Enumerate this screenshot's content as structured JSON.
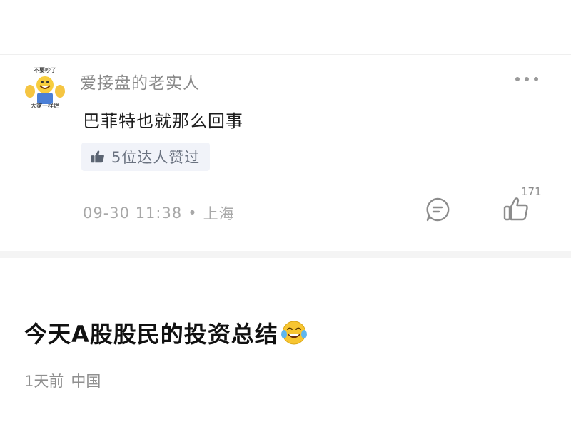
{
  "comment": {
    "avatar": {
      "caption_top": "不要吵了",
      "caption_bottom": "大家一样烂"
    },
    "username": "爱接盘的老实人",
    "text": "巴菲特也就那么回事",
    "expert_badge": {
      "icon": "thumbs-up-icon",
      "label": "5位达人赞过"
    },
    "date": "09-30 11:38",
    "separator": "•",
    "location": "上海",
    "reply_icon": "reply-bubble-icon",
    "like_icon": "like-thumb-icon",
    "like_count": "171",
    "more_icon": "more-dots-icon"
  },
  "post": {
    "title": "今天A股股民的投资总结",
    "title_emoji": "laughing-tears-emoji",
    "time": "1天前",
    "region": "中国"
  },
  "colors": {
    "divider": "#efefef",
    "gap": "#f4f4f4",
    "badge_bg": "#f1f3f9",
    "emoji_yellow": "#f7c531"
  }
}
